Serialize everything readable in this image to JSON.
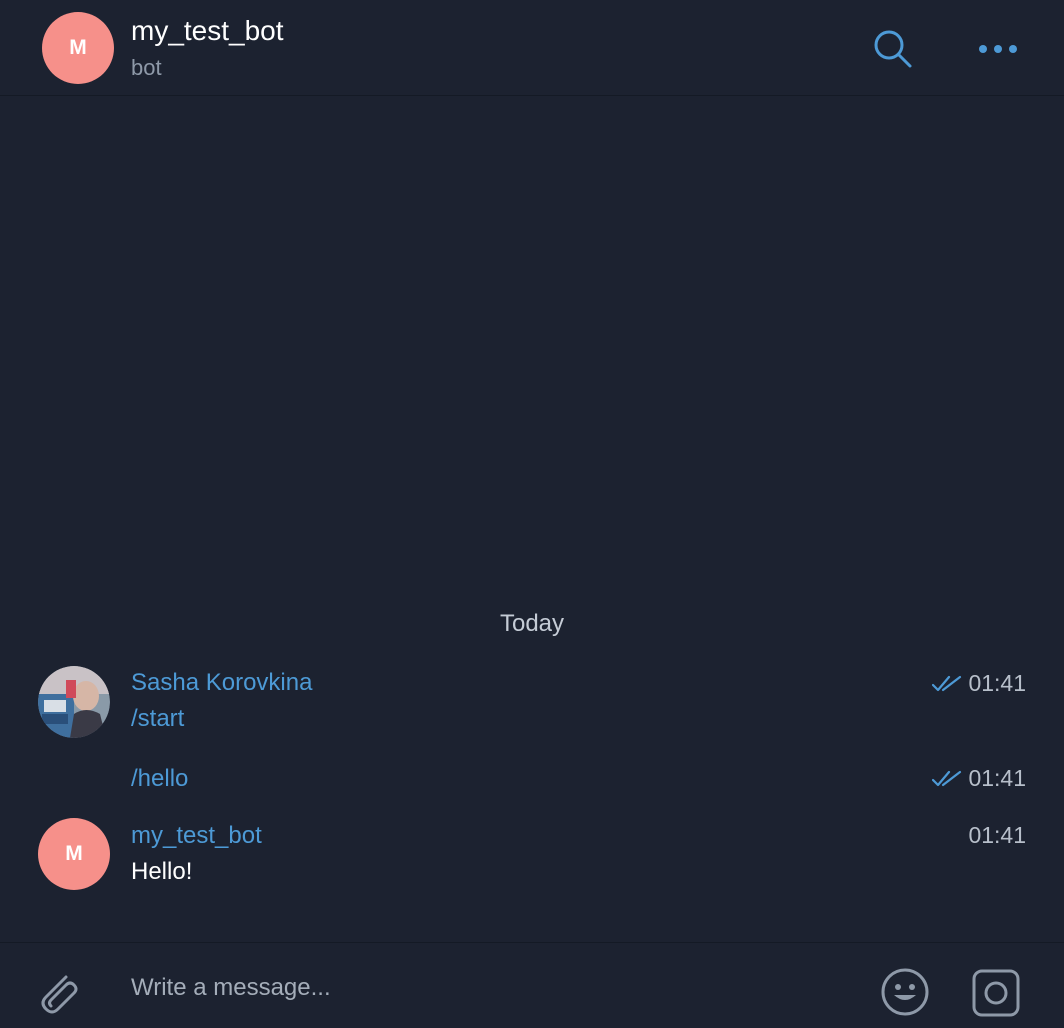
{
  "header": {
    "avatar_letter": "M",
    "title": "my_test_bot",
    "subtitle": "bot",
    "search_icon": "search-icon",
    "more_icon": "more-dots-icon"
  },
  "chat": {
    "date_separator": "Today",
    "messages": [
      {
        "sender": "Sasha Korovkina",
        "text": "/start",
        "time": "01:41",
        "status": "read"
      },
      {
        "sender": "",
        "text": "/hello",
        "time": "01:41",
        "status": "read"
      },
      {
        "sender": "my_test_bot",
        "avatar_letter": "M",
        "text": "Hello!",
        "time": "01:41",
        "status": ""
      }
    ]
  },
  "composer": {
    "placeholder": "Write a message...",
    "attach_icon": "paperclip-icon",
    "emoji_icon": "smiley-icon",
    "camera_icon": "camera-icon"
  },
  "colors": {
    "background": "#1c2230",
    "accent": "#4d9ad6",
    "avatar": "#f6908a"
  }
}
